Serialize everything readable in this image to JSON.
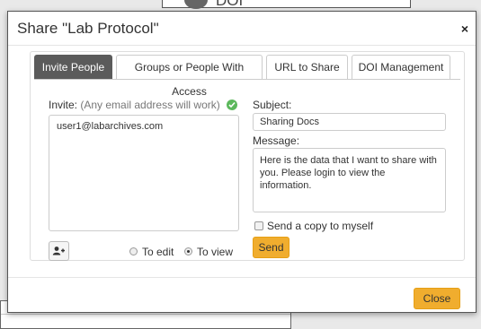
{
  "background": {
    "peek_text": "DOI"
  },
  "dialog": {
    "title": "Share \"Lab Protocol\"",
    "close_glyph": "×",
    "close_button_label": "Close"
  },
  "tabs": [
    {
      "label": "Invite People",
      "active": true
    },
    {
      "label": "Groups or People With Access",
      "active": false
    },
    {
      "label": "URL to Share",
      "active": false
    },
    {
      "label": "DOI Management",
      "active": false
    }
  ],
  "invite": {
    "label": "Invite:",
    "hint": "(Any email address will work)",
    "value": "user1@labarchives.com",
    "permission_options": [
      {
        "label": "To edit",
        "selected": false
      },
      {
        "label": "To view",
        "selected": true
      }
    ]
  },
  "subject": {
    "label": "Subject:",
    "value": "Sharing Docs"
  },
  "message": {
    "label": "Message:",
    "value": "Here is the data that I want to share with you. Please login to view the information."
  },
  "copy_to_self": {
    "label": "Send a copy to myself",
    "checked": false
  },
  "send_button_label": "Send",
  "colors": {
    "accent": "#f0ad2e",
    "active_tab": "#5b5b5b",
    "check_ok": "#5cb85c"
  },
  "icons": {
    "valid": "check-circle-icon",
    "add_contact": "add-user-icon",
    "close": "close-icon"
  }
}
